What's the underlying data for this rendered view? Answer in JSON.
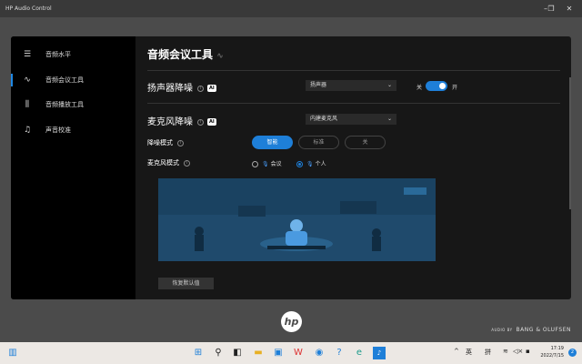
{
  "window": {
    "title": "HP Audio Control",
    "minimize": "–",
    "restore": "❐",
    "close": "✕"
  },
  "sidebar": {
    "items": [
      {
        "label": "音频水平",
        "icon": "sliders-icon"
      },
      {
        "label": "音频会议工具",
        "icon": "waveform-icon"
      },
      {
        "label": "音频播放工具",
        "icon": "equalizer-icon"
      },
      {
        "label": "声音校准",
        "icon": "music-note-icon"
      }
    ]
  },
  "main": {
    "title": "音频会议工具",
    "speaker": {
      "title": "扬声器降噪",
      "ai": "AI",
      "info": "i",
      "device": "扬声器",
      "off_label": "关",
      "on_label": "开",
      "enabled": true
    },
    "mic": {
      "title": "麦克风降噪",
      "ai": "AI",
      "info": "i",
      "device": "内建麦克风",
      "mode_label": "降噪模式",
      "modes": [
        "智能",
        "标准",
        "关"
      ],
      "selected_mode": "智能",
      "mic_mode_label": "麦克风模式",
      "mic_modes": [
        "会议",
        "个人"
      ],
      "selected_mic_mode": "个人"
    },
    "reset_label": "恢复默认值"
  },
  "branding": {
    "hp": "hp",
    "audio_by": "AUDIO BY",
    "bo": "BANG & OLUFSEN"
  },
  "taskbar": {
    "ime1": "英",
    "ime2": "拼",
    "time": "17:19",
    "date": "2022/7/15",
    "notifications": "2"
  },
  "colors": {
    "accent": "#1e7fd8",
    "panel": "#171717",
    "sidebar": "#000000",
    "illustration": "#1f4a6c"
  }
}
